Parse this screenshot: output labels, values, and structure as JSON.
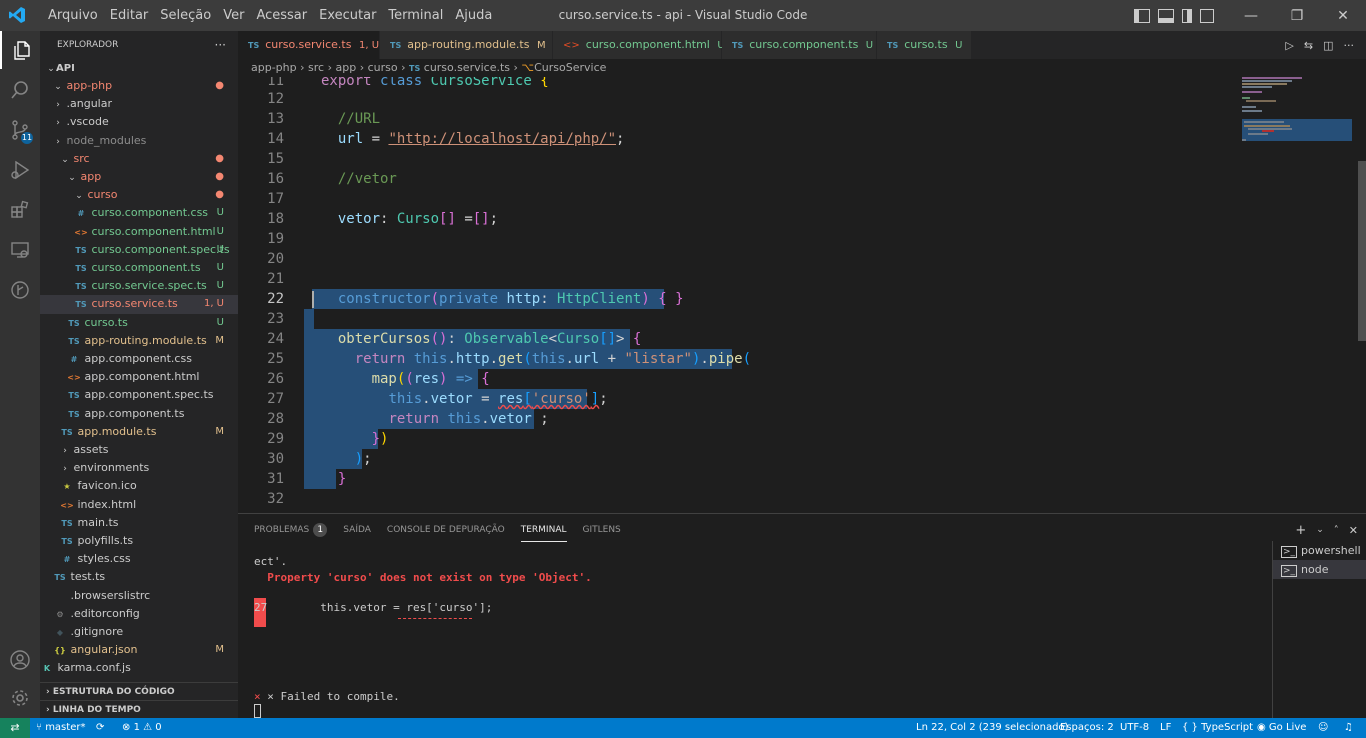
{
  "window": {
    "title": "curso.service.ts - api - Visual Studio Code",
    "menu": [
      "Arquivo",
      "Editar",
      "Seleção",
      "Ver",
      "Acessar",
      "Executar",
      "Terminal",
      "Ajuda"
    ],
    "controls": {
      "minimize": "—",
      "maximize": "❐",
      "close": "✕"
    }
  },
  "activity_bar": {
    "scm_badge": "11"
  },
  "explorer": {
    "title": "EXPLORADOR",
    "more": "···",
    "root": "API",
    "items": [
      {
        "label": "app-php",
        "type": "folder",
        "status": "●"
      },
      {
        "label": ".angular",
        "type": "folder",
        "status": ""
      },
      {
        "label": ".vscode",
        "type": "folder",
        "status": ""
      },
      {
        "label": "node_modules",
        "type": "folder",
        "status": ""
      },
      {
        "label": "src",
        "type": "folder",
        "status": "●"
      },
      {
        "label": "app",
        "type": "folder",
        "status": "●"
      },
      {
        "label": "curso",
        "type": "folder",
        "status": "●"
      },
      {
        "label": "curso.component.css",
        "type": "css",
        "status": "U"
      },
      {
        "label": "curso.component.html",
        "type": "html",
        "status": "U"
      },
      {
        "label": "curso.component.spec.ts",
        "type": "ts",
        "status": "U"
      },
      {
        "label": "curso.component.ts",
        "type": "ts",
        "status": "U"
      },
      {
        "label": "curso.service.spec.ts",
        "type": "ts",
        "status": "U"
      },
      {
        "label": "curso.service.ts",
        "type": "ts",
        "status": "1, U"
      },
      {
        "label": "curso.ts",
        "type": "ts",
        "status": "U"
      },
      {
        "label": "app-routing.module.ts",
        "type": "ts",
        "status": "M"
      },
      {
        "label": "app.component.css",
        "type": "css",
        "status": ""
      },
      {
        "label": "app.component.html",
        "type": "html",
        "status": ""
      },
      {
        "label": "app.component.spec.ts",
        "type": "ts",
        "status": ""
      },
      {
        "label": "app.component.ts",
        "type": "ts",
        "status": ""
      },
      {
        "label": "app.module.ts",
        "type": "ts",
        "status": "M"
      },
      {
        "label": "assets",
        "type": "folder",
        "status": ""
      },
      {
        "label": "environments",
        "type": "folder",
        "status": ""
      },
      {
        "label": "favicon.ico",
        "type": "star",
        "status": ""
      },
      {
        "label": "index.html",
        "type": "html",
        "status": ""
      },
      {
        "label": "main.ts",
        "type": "ts",
        "status": ""
      },
      {
        "label": "polyfills.ts",
        "type": "ts",
        "status": ""
      },
      {
        "label": "styles.css",
        "type": "css",
        "status": ""
      },
      {
        "label": "test.ts",
        "type": "ts",
        "status": ""
      },
      {
        "label": ".browserslistrc",
        "type": "plain",
        "status": ""
      },
      {
        "label": ".editorconfig",
        "type": "gear",
        "status": ""
      },
      {
        "label": ".gitignore",
        "type": "git",
        "status": ""
      },
      {
        "label": "angular.json",
        "type": "json",
        "status": "M"
      },
      {
        "label": "karma.conf.js",
        "type": "karma",
        "status": ""
      }
    ],
    "sections": [
      "ESTRUTURA DO CÓDIGO",
      "LINHA DO TEMPO"
    ]
  },
  "tabs": [
    {
      "label": "curso.service.ts",
      "badge": "1, U",
      "icon": "TS"
    },
    {
      "label": "app-routing.module.ts",
      "badge": "M",
      "icon": "TS"
    },
    {
      "label": "curso.component.html",
      "badge": "U",
      "icon": "<>"
    },
    {
      "label": "curso.component.ts",
      "badge": "U",
      "icon": "TS"
    },
    {
      "label": "curso.ts",
      "badge": "U",
      "icon": "TS"
    }
  ],
  "breadcrumbs": [
    "app-php",
    "src",
    "app",
    "curso",
    "curso.service.ts",
    "CursoService"
  ],
  "editor": {
    "line_numbers": [
      "11",
      "12",
      "13",
      "14",
      "15",
      "16",
      "17",
      "18",
      "19",
      "20",
      "21",
      "22",
      "23",
      "24",
      "25",
      "26",
      "27",
      "28",
      "29",
      "30",
      "31",
      "32"
    ],
    "current_line": "22"
  },
  "panel": {
    "tabs": [
      "PROBLEMAS",
      "SAÍDA",
      "CONSOLE DE DEPURAÇÃO",
      "TERMINAL",
      "GITLENS"
    ],
    "problems_count": "1",
    "terminal_lines": [
      "ect'.",
      "  Property 'curso' does not exist on type 'Object'.",
      "27        this.vetor = res['curso'];",
      "× Failed to compile."
    ],
    "terminals": [
      "powershell",
      "node"
    ]
  },
  "statusbar": {
    "branch": "master*",
    "errors": "1",
    "warnings": "0",
    "position": "Ln 22, Col 2 (239 selecionado)",
    "spaces": "Espaços: 2",
    "encoding": "UTF-8",
    "eol": "LF",
    "language": "TypeScript",
    "golive": "Go Live"
  }
}
